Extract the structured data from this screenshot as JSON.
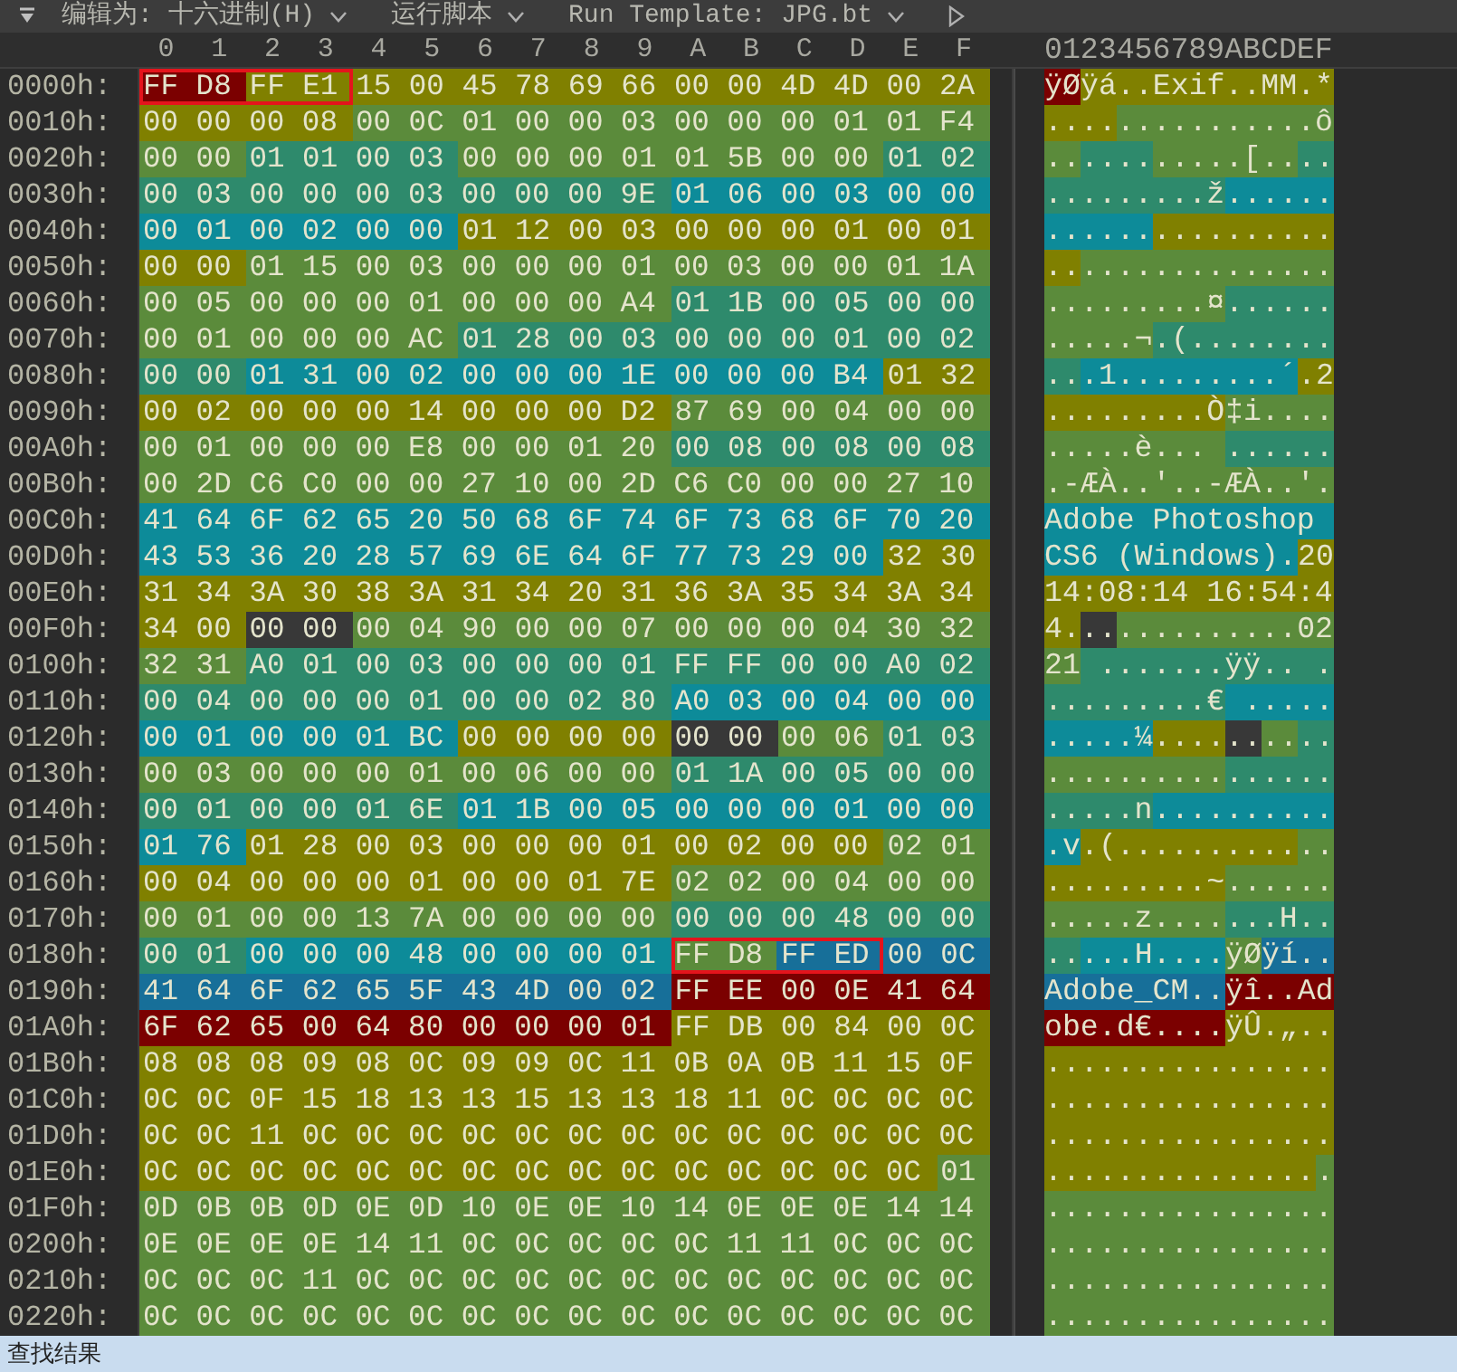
{
  "toolbar": {
    "items": [
      {
        "kind": "menu",
        "label": "编辑为: 十六进制(H)"
      },
      {
        "kind": "menu",
        "label": "运行脚本"
      },
      {
        "kind": "menu",
        "label": "Run Template: JPG.bt"
      },
      {
        "kind": "run"
      }
    ]
  },
  "hex_view": {
    "columns": [
      "0",
      "1",
      "2",
      "3",
      "4",
      "5",
      "6",
      "7",
      "8",
      "9",
      "A",
      "B",
      "C",
      "D",
      "E",
      "F"
    ],
    "ascii_header": "0123456789ABCDEF",
    "rows": [
      {
        "offset": "0000h:",
        "runs": [
          {
            "bytes": "FF D8",
            "ascii": "ÿØ",
            "color": "#7b0000",
            "boxed": true
          },
          {
            "bytes": "FF E1",
            "ascii": "ÿá",
            "color": "#808000",
            "boxed": true
          },
          {
            "bytes": "15 00 45 78 69 66 00 00 4D 4D 00 2A",
            "ascii": "..Exif..MM.*",
            "color": "#808000",
            "boxed": false
          }
        ]
      },
      {
        "offset": "0010h:",
        "runs": [
          {
            "bytes": "00 00 00 08",
            "ascii": "....",
            "color": "#808000",
            "boxed": false
          },
          {
            "bytes": "00 0C 01 00 00 03 00 00 00 01 01 F4",
            "ascii": "...........ô",
            "color": "#5b8b3b",
            "boxed": false
          }
        ]
      },
      {
        "offset": "0020h:",
        "runs": [
          {
            "bytes": "00 00",
            "ascii": "..",
            "color": "#5b8b3b",
            "boxed": false
          },
          {
            "bytes": "01 01 00 03",
            "ascii": "....",
            "color": "#2e8a6c",
            "boxed": false
          },
          {
            "bytes": "00 00 00 01 01 5B 00 00",
            "ascii": ".....[..",
            "color": "#5b8b3b",
            "boxed": false
          },
          {
            "bytes": "01 02",
            "ascii": "..",
            "color": "#2e8a6c",
            "boxed": false
          }
        ]
      },
      {
        "offset": "0030h:",
        "runs": [
          {
            "bytes": "00 03 00 00 00 03 00 00 00 9E",
            "ascii": ".........ž",
            "color": "#2e8a6c",
            "boxed": false
          },
          {
            "bytes": "01 06 00 03 00 00",
            "ascii": "......",
            "color": "#0d8b99",
            "boxed": false
          }
        ]
      },
      {
        "offset": "0040h:",
        "runs": [
          {
            "bytes": "00 01 00 02 00 00",
            "ascii": "......",
            "color": "#0d8b99",
            "boxed": false
          },
          {
            "bytes": "01 12 00 03 00 00 00 01 00 01",
            "ascii": "..........",
            "color": "#808000",
            "boxed": false
          }
        ]
      },
      {
        "offset": "0050h:",
        "runs": [
          {
            "bytes": "00 00",
            "ascii": "..",
            "color": "#808000",
            "boxed": false
          },
          {
            "bytes": "01 15 00 03 00 00 00 01 00 03 00 00 01 1A",
            "ascii": "..............",
            "color": "#5b8b3b",
            "boxed": false
          }
        ]
      },
      {
        "offset": "0060h:",
        "runs": [
          {
            "bytes": "00 05 00 00 00 01 00 00 00 A4",
            "ascii": ".........¤",
            "color": "#5b8b3b",
            "boxed": false
          },
          {
            "bytes": "01 1B 00 05 00 00",
            "ascii": "......",
            "color": "#2e8a6c",
            "boxed": false
          }
        ]
      },
      {
        "offset": "0070h:",
        "runs": [
          {
            "bytes": "00 01 00 00 00 AC",
            "ascii": ".....¬",
            "color": "#5b8b3b",
            "boxed": false
          },
          {
            "bytes": "01 28 00 03 00 00 00 01 00 02",
            "ascii": ".(........",
            "color": "#2e8a6c",
            "boxed": false
          }
        ]
      },
      {
        "offset": "0080h:",
        "runs": [
          {
            "bytes": "00 00",
            "ascii": "..",
            "color": "#2e8a6c",
            "boxed": false
          },
          {
            "bytes": "01 31 00 02 00 00 00 1E 00 00 00 B4",
            "ascii": ".1.........´",
            "color": "#0d8b99",
            "boxed": false
          },
          {
            "bytes": "01 32",
            "ascii": ".2",
            "color": "#808000",
            "boxed": false
          }
        ]
      },
      {
        "offset": "0090h:",
        "runs": [
          {
            "bytes": "00 02 00 00 00 14 00 00 00 D2",
            "ascii": ".........Ò",
            "color": "#808000",
            "boxed": false
          },
          {
            "bytes": "87 69 00 04 00 00",
            "ascii": "‡i....",
            "color": "#5b8b3b",
            "boxed": false
          }
        ]
      },
      {
        "offset": "00A0h:",
        "runs": [
          {
            "bytes": "00 01 00 00 00 E8 00 00 01 20",
            "ascii": ".....è... ",
            "color": "#5b8b3b",
            "boxed": false
          },
          {
            "bytes": "00 08 00 08 00 08",
            "ascii": "......",
            "color": "#2e8a6c",
            "boxed": false
          }
        ]
      },
      {
        "offset": "00B0h:",
        "runs": [
          {
            "bytes": "00 2D C6 C0 00 00 27 10 00 2D C6 C0 00 00 27 10",
            "ascii": ".-ÆÀ..'..-ÆÀ..'.",
            "color": "#5b8b3b",
            "boxed": false
          }
        ]
      },
      {
        "offset": "00C0h:",
        "runs": [
          {
            "bytes": "41 64 6F 62 65 20 50 68 6F 74 6F 73 68 6F 70 20",
            "ascii": "Adobe Photoshop ",
            "color": "#0d8b99",
            "boxed": false
          }
        ]
      },
      {
        "offset": "00D0h:",
        "runs": [
          {
            "bytes": "43 53 36 20 28 57 69 6E 64 6F 77 73 29 00",
            "ascii": "CS6 (Windows).",
            "color": "#0d8b99",
            "boxed": false
          },
          {
            "bytes": "32 30",
            "ascii": "20",
            "color": "#808000",
            "boxed": false
          }
        ]
      },
      {
        "offset": "00E0h:",
        "runs": [
          {
            "bytes": "31 34 3A 30 38 3A 31 34 20 31 36 3A 35 34 3A 34",
            "ascii": "14:08:14 16:54:4",
            "color": "#808000",
            "boxed": false
          }
        ]
      },
      {
        "offset": "00F0h:",
        "runs": [
          {
            "bytes": "34 00",
            "ascii": "4.",
            "color": "#808000",
            "boxed": false
          },
          {
            "bytes": "00 00",
            "ascii": "..",
            "color": "#383838",
            "boxed": false
          },
          {
            "bytes": "00 04 90 00 00 07 00 00 00 04 30 32",
            "ascii": "..........02",
            "color": "#5b8b3b",
            "boxed": false
          }
        ]
      },
      {
        "offset": "0100h:",
        "runs": [
          {
            "bytes": "32 31",
            "ascii": "21",
            "color": "#5b8b3b",
            "boxed": false
          },
          {
            "bytes": "A0 01 00 03 00 00 00 01 FF FF 00 00 A0 02",
            "ascii": " .......ÿÿ.. .",
            "color": "#2e8a6c",
            "boxed": false
          }
        ]
      },
      {
        "offset": "0110h:",
        "runs": [
          {
            "bytes": "00 04 00 00 00 01 00 00 02 80",
            "ascii": ".........€",
            "color": "#2e8a6c",
            "boxed": false
          },
          {
            "bytes": "A0 03 00 04 00 00",
            "ascii": " .....",
            "color": "#0d8b99",
            "boxed": false
          }
        ]
      },
      {
        "offset": "0120h:",
        "runs": [
          {
            "bytes": "00 01 00 00 01 BC",
            "ascii": ".....¼",
            "color": "#0d8b99",
            "boxed": false
          },
          {
            "bytes": "00 00 00 00",
            "ascii": "....",
            "color": "#808000",
            "boxed": false
          },
          {
            "bytes": "00 00",
            "ascii": "..",
            "color": "#383838",
            "boxed": false
          },
          {
            "bytes": "00 06",
            "ascii": "..",
            "color": "#5b8b3b",
            "boxed": false
          },
          {
            "bytes": "01 03",
            "ascii": "..",
            "color": "#2e8a6c",
            "boxed": false
          }
        ]
      },
      {
        "offset": "0130h:",
        "runs": [
          {
            "bytes": "00 03 00 00 00 01 00 06 00 00",
            "ascii": "..........",
            "color": "#5b8b3b",
            "boxed": false
          },
          {
            "bytes": "01 1A 00 05 00 00",
            "ascii": "......",
            "color": "#2e8a6c",
            "boxed": false
          }
        ]
      },
      {
        "offset": "0140h:",
        "runs": [
          {
            "bytes": "00 01 00 00 01 6E",
            "ascii": ".....n",
            "color": "#2e8a6c",
            "boxed": false
          },
          {
            "bytes": "01 1B 00 05 00 00 00 01 00 00",
            "ascii": "..........",
            "color": "#0d8b99",
            "boxed": false
          }
        ]
      },
      {
        "offset": "0150h:",
        "runs": [
          {
            "bytes": "01 76",
            "ascii": ".v",
            "color": "#0d8b99",
            "boxed": false
          },
          {
            "bytes": "01 28 00 03 00 00 00 01 00 02 00 00",
            "ascii": ".(..........",
            "color": "#808000",
            "boxed": false
          },
          {
            "bytes": "02 01",
            "ascii": "..",
            "color": "#5b8b3b",
            "boxed": false
          }
        ]
      },
      {
        "offset": "0160h:",
        "runs": [
          {
            "bytes": "00 04 00 00 00 01 00 00 01 7E",
            "ascii": ".........~",
            "color": "#808000",
            "boxed": false
          },
          {
            "bytes": "02 02 00 04 00 00",
            "ascii": "......",
            "color": "#5b8b3b",
            "boxed": false
          }
        ]
      },
      {
        "offset": "0170h:",
        "runs": [
          {
            "bytes": "00 01 00 00 13 7A 00 00 00 00",
            "ascii": ".....z....",
            "color": "#5b8b3b",
            "boxed": false
          },
          {
            "bytes": "00 00 00 48 00 00",
            "ascii": "...H..",
            "color": "#2e8a6c",
            "boxed": false
          }
        ]
      },
      {
        "offset": "0180h:",
        "runs": [
          {
            "bytes": "00 01",
            "ascii": "..",
            "color": "#2e8a6c",
            "boxed": false
          },
          {
            "bytes": "00 00 00 48 00 00 00 01",
            "ascii": "...H....",
            "color": "#0d8b99",
            "boxed": false
          },
          {
            "bytes": "FF D8",
            "ascii": "ÿØ",
            "color": "#5b8b3b",
            "boxed": true
          },
          {
            "bytes": "FF ED",
            "ascii": "ÿí",
            "color": "#176f99",
            "boxed": true
          },
          {
            "bytes": "00 0C",
            "ascii": "..",
            "color": "#176f99",
            "boxed": false
          }
        ]
      },
      {
        "offset": "0190h:",
        "runs": [
          {
            "bytes": "41 64 6F 62 65 5F 43 4D 00 02",
            "ascii": "Adobe_CM..",
            "color": "#176f99",
            "boxed": false
          },
          {
            "bytes": "FF EE 00 0E 41 64",
            "ascii": "ÿî..Ad",
            "color": "#7b0000",
            "boxed": false
          }
        ]
      },
      {
        "offset": "01A0h:",
        "runs": [
          {
            "bytes": "6F 62 65 00 64 80 00 00 00 01",
            "ascii": "obe.d€....",
            "color": "#7b0000",
            "boxed": false
          },
          {
            "bytes": "FF DB 00 84 00 0C",
            "ascii": "ÿÛ.„..",
            "color": "#808000",
            "boxed": false
          }
        ]
      },
      {
        "offset": "01B0h:",
        "runs": [
          {
            "bytes": "08 08 08 09 08 0C 09 09 0C 11 0B 0A 0B 11 15 0F",
            "ascii": "................",
            "color": "#808000",
            "boxed": false
          }
        ]
      },
      {
        "offset": "01C0h:",
        "runs": [
          {
            "bytes": "0C 0C 0F 15 18 13 13 15 13 13 18 11 0C 0C 0C 0C",
            "ascii": "................",
            "color": "#808000",
            "boxed": false
          }
        ]
      },
      {
        "offset": "01D0h:",
        "runs": [
          {
            "bytes": "0C 0C 11 0C 0C 0C 0C 0C 0C 0C 0C 0C 0C 0C 0C 0C",
            "ascii": "................",
            "color": "#808000",
            "boxed": false
          }
        ]
      },
      {
        "offset": "01E0h:",
        "runs": [
          {
            "bytes": "0C 0C 0C 0C 0C 0C 0C 0C 0C 0C 0C 0C 0C 0C 0C",
            "ascii": "...............",
            "color": "#808000",
            "boxed": false
          },
          {
            "bytes": "01",
            "ascii": ".",
            "color": "#5b8b3b",
            "boxed": false
          }
        ]
      },
      {
        "offset": "01F0h:",
        "runs": [
          {
            "bytes": "0D 0B 0B 0D 0E 0D 10 0E 0E 10 14 0E 0E 0E 14 14",
            "ascii": "................",
            "color": "#5b8b3b",
            "boxed": false
          }
        ]
      },
      {
        "offset": "0200h:",
        "runs": [
          {
            "bytes": "0E 0E 0E 0E 14 11 0C 0C 0C 0C 0C 11 11 0C 0C 0C",
            "ascii": "................",
            "color": "#5b8b3b",
            "boxed": false
          }
        ]
      },
      {
        "offset": "0210h:",
        "runs": [
          {
            "bytes": "0C 0C 0C 11 0C 0C 0C 0C 0C 0C 0C 0C 0C 0C 0C 0C",
            "ascii": "................",
            "color": "#5b8b3b",
            "boxed": false
          }
        ]
      },
      {
        "offset": "0220h:",
        "runs": [
          {
            "bytes": "0C 0C 0C 0C 0C 0C 0C 0C 0C 0C 0C 0C 0C 0C 0C 0C",
            "ascii": "................",
            "color": "#5b8b3b",
            "boxed": false
          }
        ]
      }
    ]
  },
  "bottom_panel": {
    "title": "查找结果"
  }
}
